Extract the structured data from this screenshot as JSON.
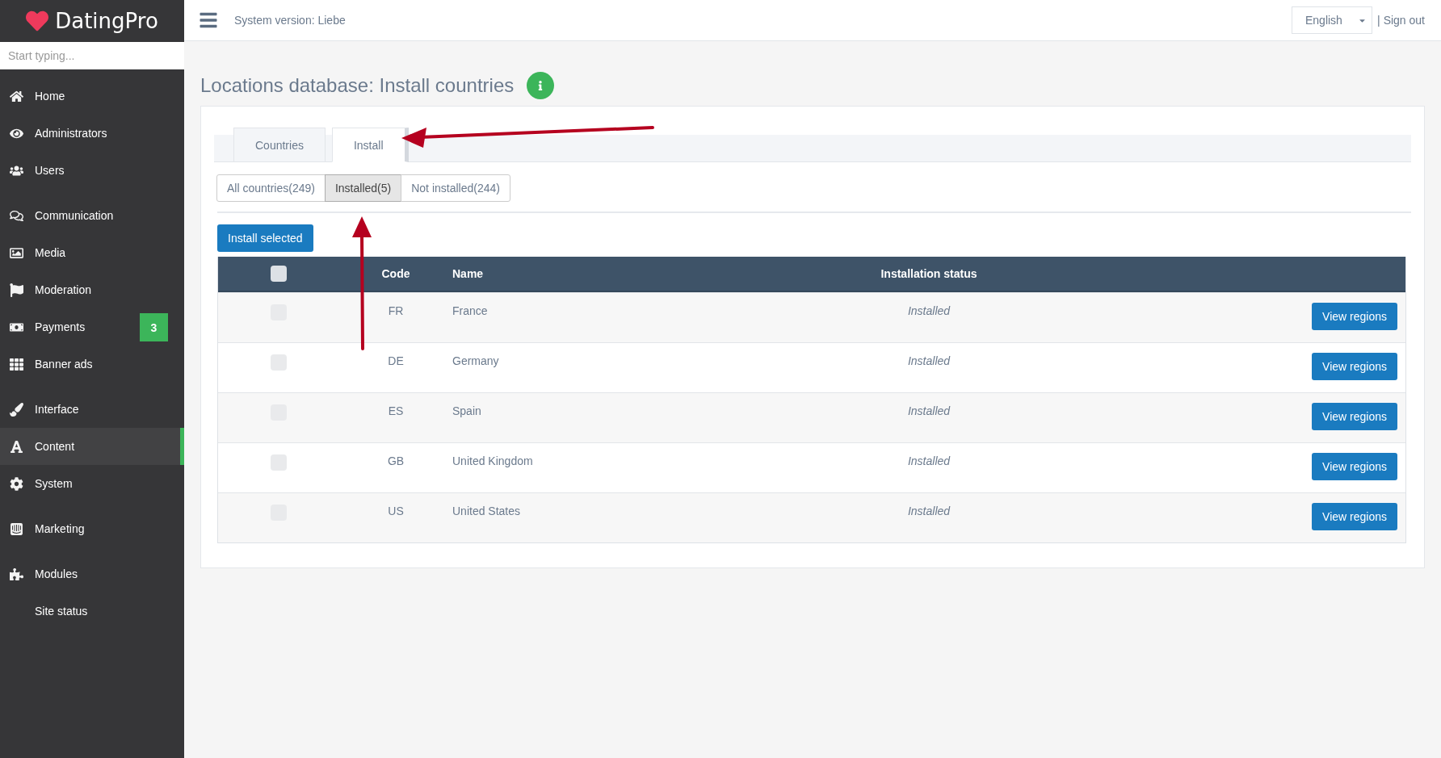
{
  "sidebar": {
    "logo": "DatingPro",
    "search": {
      "placeholder": "Start typing..."
    },
    "groups": [
      [
        {
          "label": "Home",
          "selected": false
        },
        {
          "label": "Administrators",
          "selected": false
        },
        {
          "label": "Users",
          "selected": false
        }
      ],
      [
        {
          "label": "Communication",
          "selected": false
        },
        {
          "label": "Media",
          "selected": false
        },
        {
          "label": "Moderation",
          "selected": false
        },
        {
          "label": "Payments",
          "selected": false,
          "badge": "3"
        },
        {
          "label": "Banner ads",
          "selected": false
        }
      ],
      [
        {
          "label": "Interface",
          "selected": false
        },
        {
          "label": "Content",
          "selected": true
        },
        {
          "label": "System",
          "selected": false
        }
      ],
      [
        {
          "label": "Marketing",
          "selected": false
        }
      ],
      [
        {
          "label": "Modules",
          "selected": false
        },
        {
          "label": "Site status",
          "selected": false
        }
      ]
    ]
  },
  "header": {
    "system_version": "System version: Liebe",
    "language": "English",
    "separator": "|",
    "sign_out": "Sign out"
  },
  "page": {
    "title": "Locations database: Install countries",
    "tabs": [
      {
        "label": "Countries",
        "selected": false
      },
      {
        "label": "Install",
        "selected": true
      }
    ],
    "filters": [
      {
        "label": "All countries(249)",
        "selected": false
      },
      {
        "label": "Installed(5)",
        "selected": true
      },
      {
        "label": "Not installed(244)",
        "selected": false
      }
    ],
    "install_button": "Install selected",
    "table": {
      "select_all_checked": false,
      "columns": [
        "Code",
        "Name",
        "Installation status"
      ],
      "rows": [
        {
          "checked": false,
          "code": "FR",
          "name": "France",
          "status": "Installed",
          "action": "View regions"
        },
        {
          "checked": false,
          "code": "DE",
          "name": "Germany",
          "status": "Installed",
          "action": "View regions"
        },
        {
          "checked": false,
          "code": "ES",
          "name": "Spain",
          "status": "Installed",
          "action": "View regions"
        },
        {
          "checked": false,
          "code": "GB",
          "name": "United Kingdom",
          "status": "Installed",
          "action": "View regions"
        },
        {
          "checked": false,
          "code": "US",
          "name": "United States",
          "status": "Installed",
          "action": "View regions"
        }
      ]
    }
  }
}
